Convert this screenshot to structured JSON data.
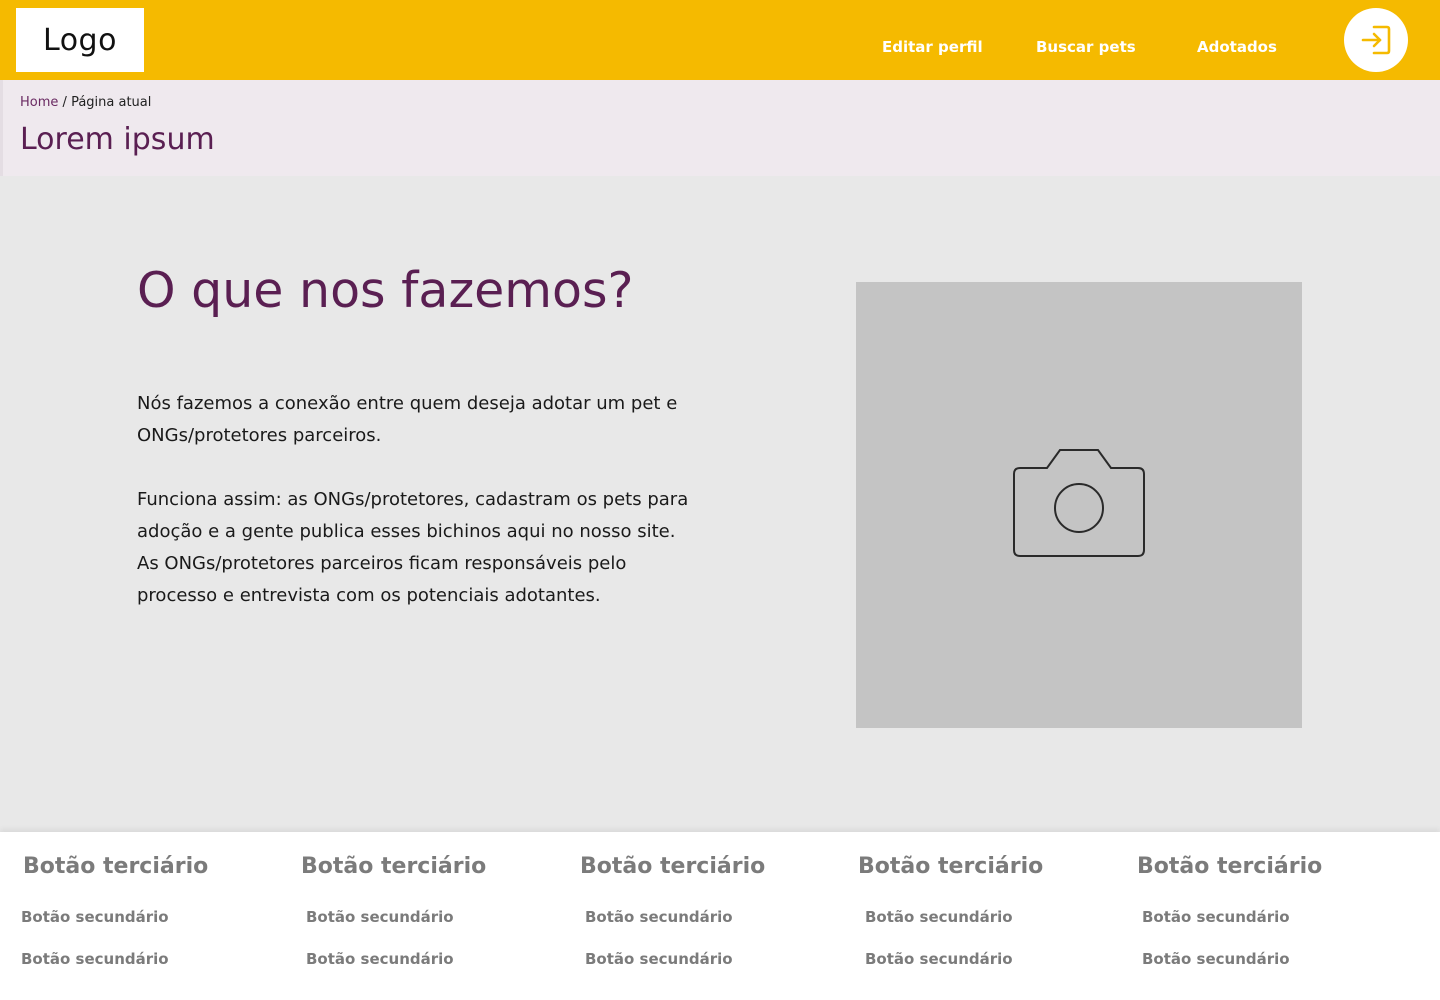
{
  "header": {
    "logo_text": "Logo",
    "nav": [
      {
        "label": "Editar perfil"
      },
      {
        "label": "Buscar pets"
      },
      {
        "label": "Adotados"
      }
    ],
    "login_icon": "login-arrow-icon",
    "colors": {
      "background": "#f5ba00",
      "nav_text": "#ffffff",
      "accent": "#f5ba00"
    }
  },
  "breadcrumb": {
    "home": "Home",
    "separator": "/",
    "current": "Página atual"
  },
  "page": {
    "title": "Lorem ipsum",
    "title_color": "#5a1f52"
  },
  "main": {
    "heading": "O que nos fazemos?",
    "paragraph_1": "Nós fazemos a conexão entre quem deseja adotar um pet e ONGs/protetores parceiros.",
    "paragraph_2_line_1": "Funciona assim: as ONGs/protetores, cadastram os pets para adoção e a gente publica esses bichinos aqui no nosso site.",
    "paragraph_2_line_2": "As ONGs/protetores parceiros ficam responsáveis pelo processo e entrevista com os potenciais adotantes.",
    "image_icon": "camera-icon",
    "image_bg": "#c4c4c4"
  },
  "footer": {
    "columns": [
      {
        "title": "Botão terciário",
        "links": [
          "Botão secundário",
          "Botão secundário"
        ]
      },
      {
        "title": "Botão terciário",
        "links": [
          "Botão secundário",
          "Botão secundário"
        ]
      },
      {
        "title": "Botão terciário",
        "links": [
          "Botão secundário",
          "Botão secundário"
        ]
      },
      {
        "title": "Botão terciário",
        "links": [
          "Botão secundário",
          "Botão secundário"
        ]
      },
      {
        "title": "Botão terciário",
        "links": [
          "Botão secundário",
          "Botão secundário"
        ]
      }
    ],
    "text_color": "#7b7b7b"
  }
}
